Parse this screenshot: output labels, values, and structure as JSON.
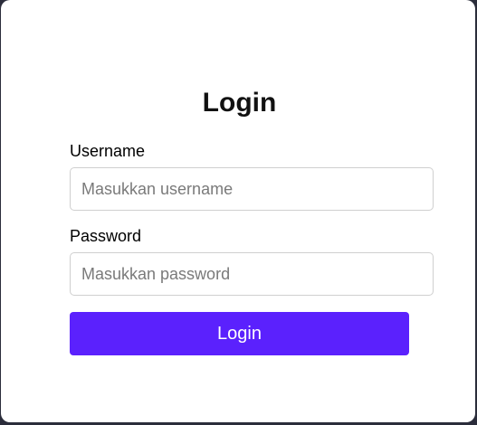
{
  "form": {
    "title": "Login",
    "username": {
      "label": "Username",
      "placeholder": "Masukkan username",
      "value": ""
    },
    "password": {
      "label": "Password",
      "placeholder": "Masukkan password",
      "value": ""
    },
    "submit_label": "Login"
  },
  "colors": {
    "accent": "#5b21fd",
    "card_background": "#ffffff",
    "page_background": "#2b2d3b"
  }
}
